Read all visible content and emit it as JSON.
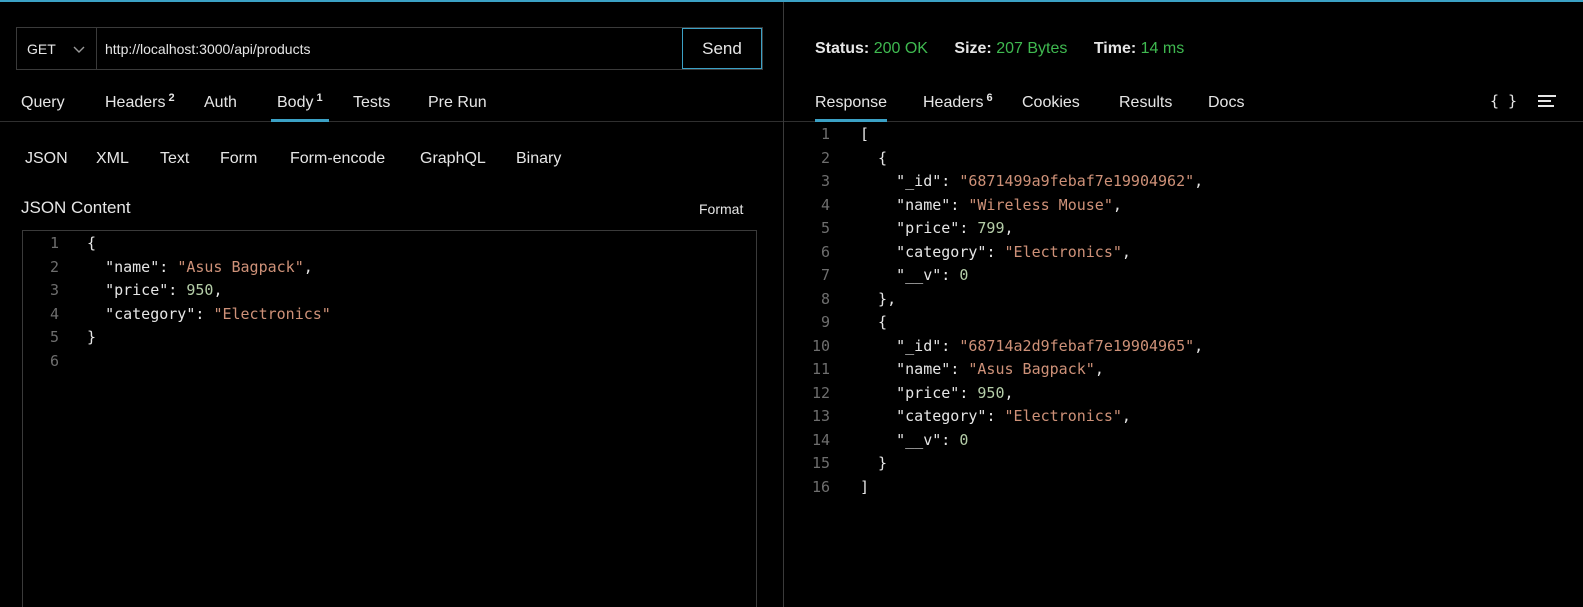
{
  "request": {
    "method": "GET",
    "url": "http://localhost:3000/api/products",
    "send_label": "Send",
    "tabs": [
      {
        "label": "Query",
        "badge": ""
      },
      {
        "label": "Headers",
        "badge": "2"
      },
      {
        "label": "Auth",
        "badge": ""
      },
      {
        "label": "Body",
        "badge": "1"
      },
      {
        "label": "Tests",
        "badge": ""
      },
      {
        "label": "Pre Run",
        "badge": ""
      }
    ],
    "body_types": [
      "JSON",
      "XML",
      "Text",
      "Form",
      "Form-encode",
      "GraphQL",
      "Binary"
    ],
    "content_label": "JSON Content",
    "format_label": "Format",
    "body_lines": [
      "{",
      "  \"name\": \"Asus Bagpack\",",
      "  \"price\": 950,",
      "  \"category\": \"Electronics\"",
      "}",
      ""
    ]
  },
  "response": {
    "status_label": "Status:",
    "status_value": "200 OK",
    "size_label": "Size:",
    "size_value": "207 Bytes",
    "time_label": "Time:",
    "time_value": "14 ms",
    "tabs": [
      {
        "label": "Response",
        "badge": ""
      },
      {
        "label": "Headers",
        "badge": "6"
      },
      {
        "label": "Cookies",
        "badge": ""
      },
      {
        "label": "Results",
        "badge": ""
      },
      {
        "label": "Docs",
        "badge": ""
      }
    ],
    "braces_icon": "{ }",
    "body_lines": [
      "[",
      "  {",
      "    \"_id\": \"6871499a9febaf7e19904962\",",
      "    \"name\": \"Wireless Mouse\",",
      "    \"price\": 799,",
      "    \"category\": \"Electronics\",",
      "    \"__v\": 0",
      "  },",
      "  {",
      "    \"_id\": \"68714a2d9febaf7e19904965\",",
      "    \"name\": \"Asus Bagpack\",",
      "    \"price\": 950,",
      "    \"category\": \"Electronics\",",
      "    \"__v\": 0",
      "  }",
      "]"
    ]
  },
  "colors": {
    "accent": "#3ba1c5",
    "status_ok": "#3fb950",
    "string": "#ce9178",
    "number": "#b5cea8"
  },
  "icons": {
    "method_dropdown": "chevron-down-icon",
    "format_toggle": "braces-icon",
    "wrap_toggle": "menu-lines-icon"
  }
}
